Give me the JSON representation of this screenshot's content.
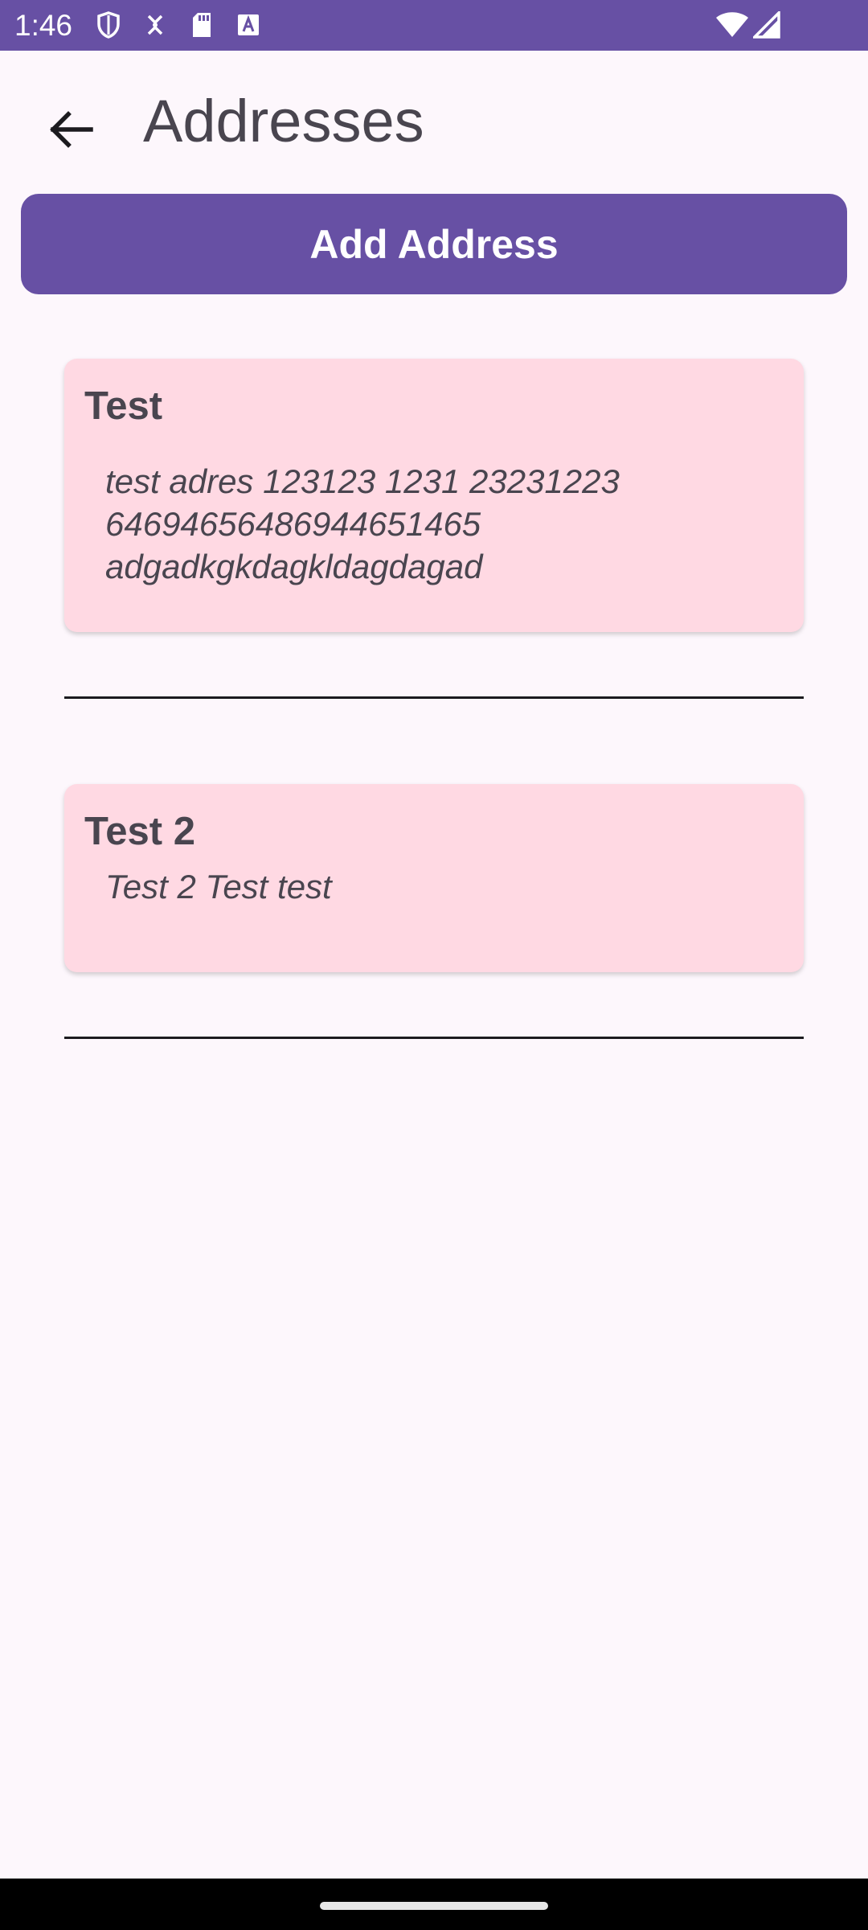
{
  "status_bar": {
    "time": "1:46",
    "icons": [
      "shield-icon",
      "sync-icon",
      "sd-card-icon",
      "font-download-icon",
      "wifi-icon",
      "cellular-signal-icon"
    ],
    "background_color": "#6750a4"
  },
  "header": {
    "title": "Addresses",
    "back_icon": "arrow-back-icon"
  },
  "actions": {
    "add_label": "Add Address",
    "accent_color": "#6750a4"
  },
  "addresses": [
    {
      "name": "Test",
      "address_lines": [
        "test adres 123123 1231 23231223",
        "646946564869446​51465",
        "adgadkgkdagkldagdagad"
      ]
    },
    {
      "name": "Test 2",
      "address_lines": [
        "Test 2 Test test"
      ]
    }
  ],
  "colors": {
    "card_background": "#ffd9e3",
    "page_background": "#fdf7fc",
    "text": "#49454f"
  }
}
